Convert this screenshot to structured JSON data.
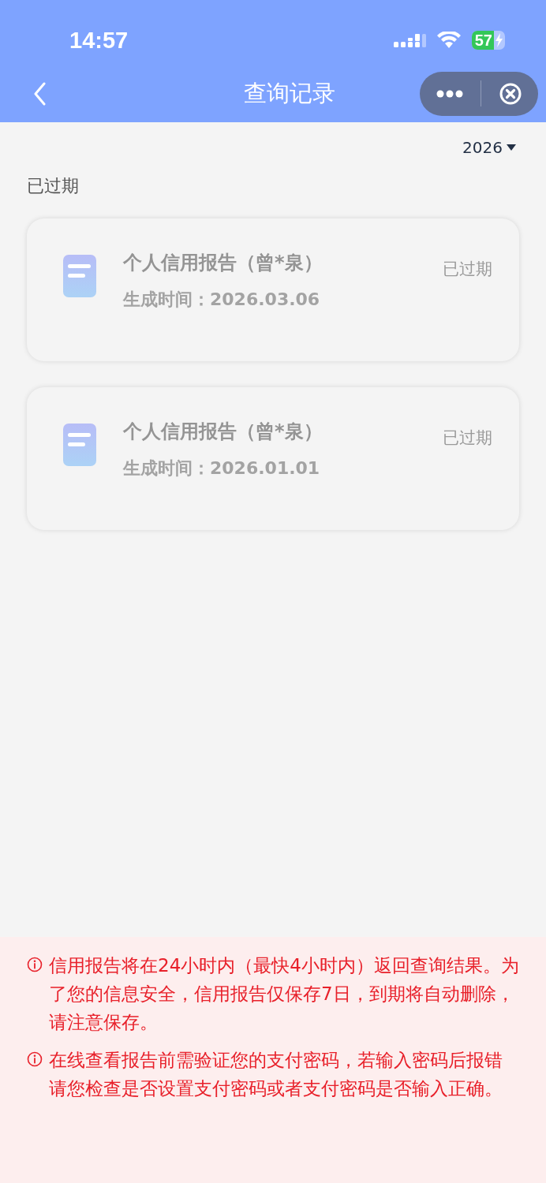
{
  "status_bar": {
    "time": "14:57",
    "battery": "57"
  },
  "nav_bar": {
    "title": "查询记录"
  },
  "year_filter": {
    "value": "2026"
  },
  "section": {
    "title": "已过期"
  },
  "reports": [
    {
      "title": "个人信用报告（曾*泉）",
      "date_label": "生成时间：",
      "date": "2026.03.06",
      "status": "已过期",
      "expired": true
    },
    {
      "title": "个人信用报告（曾*泉）",
      "date_label": "生成时间：",
      "date": "2026.01.01",
      "status": "已过期",
      "expired": true
    }
  ],
  "notices": [
    "信用报告将在24小时内（最快4小时内）返回查询结果。为了您的信息安全，信用报告仅保存7日，到期将自动删除，请注意保存。",
    "在线查看报告前需验证您的支付密码，若输入密码后报错请您检查是否设置支付密码或者支付密码是否输入正确。"
  ]
}
